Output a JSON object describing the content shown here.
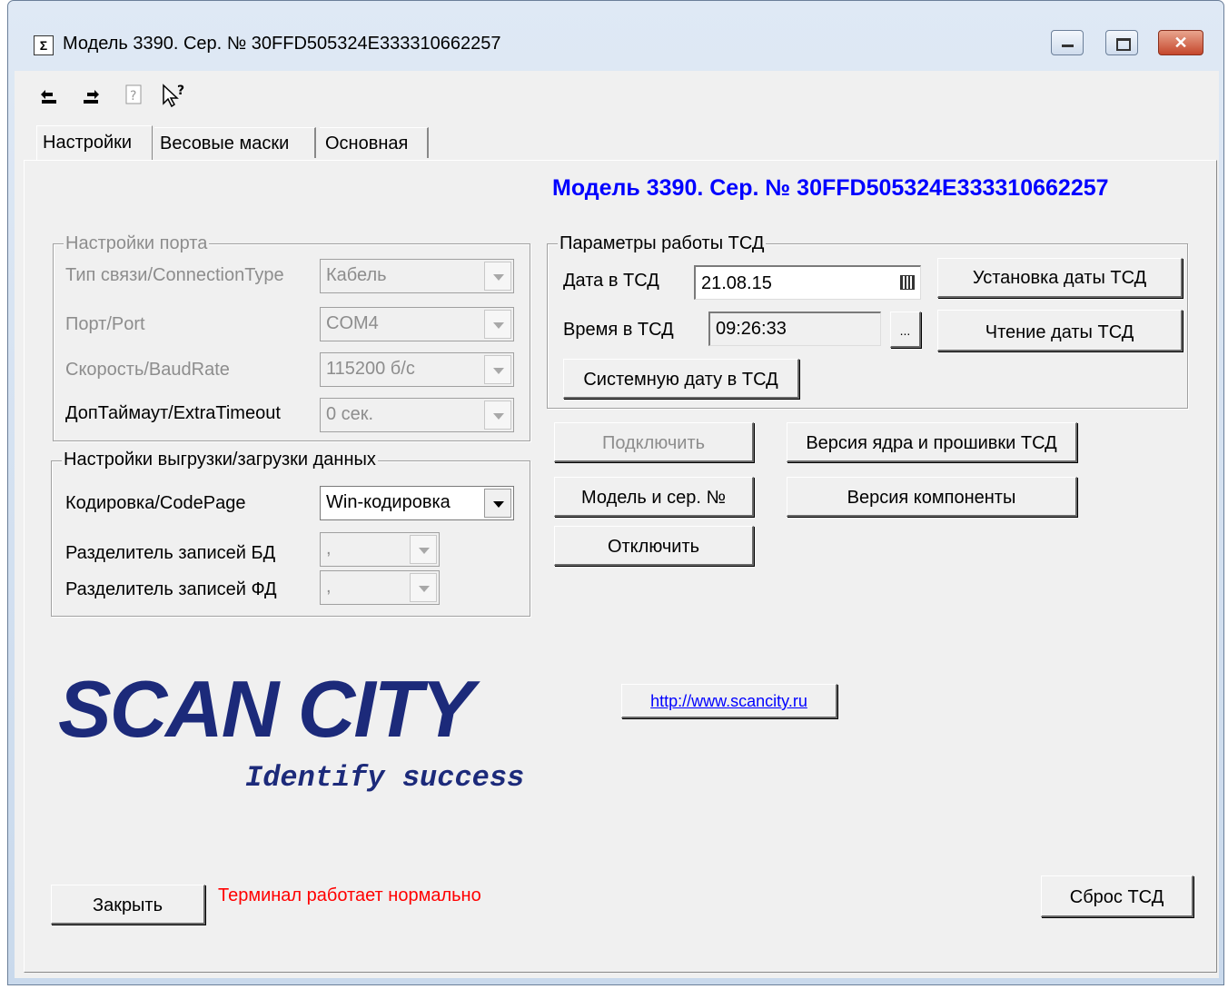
{
  "window": {
    "title": "Модель 3390. Сер. № 30FFD505324E333310662257",
    "icon": "sigma-app-icon"
  },
  "toolbar": {
    "icons": [
      "undo-icon",
      "redo-icon",
      "help-doc-icon",
      "context-help-icon"
    ]
  },
  "tabs": [
    {
      "label": "Настройки",
      "active": true
    },
    {
      "label": "Весовые маски",
      "active": false
    },
    {
      "label": "Основная",
      "active": false
    }
  ],
  "header_title": "Модель 3390. Сер. № 30FFD505324E333310662257",
  "port_group": {
    "title": "Настройки порта",
    "connection_label": "Тип связи/ConnectionType",
    "connection_value": "Кабель",
    "port_label": "Порт/Port",
    "port_value": "COM4",
    "baud_label": "Скорость/BaudRate",
    "baud_value": "115200 б/с",
    "timeout_label": "ДопТаймаут/ExtraTimeout",
    "timeout_value": "0 сек."
  },
  "data_group": {
    "title": "Настройки выгрузки/загрузки данных",
    "codepage_label": "Кодировка/CodePage",
    "codepage_value": "Win-кодировка",
    "db_sep_label": "Разделитель записей БД",
    "db_sep_value": ",",
    "fd_sep_label": "Разделитель записей ФД",
    "fd_sep_value": ","
  },
  "tsd_group": {
    "title": "Параметры работы ТСД",
    "date_label": "Дата в ТСД",
    "date_value": "21.08.15",
    "time_label": "Время в ТСД",
    "time_value": "09:26:33",
    "ellipsis": "...",
    "set_date_button": "Установка даты ТСД",
    "read_date_button": "Чтение даты ТСД",
    "system_date_button": "Системную дату в ТСД"
  },
  "actions": {
    "connect": "Подключить",
    "model_serial": "Модель и сер. №",
    "disconnect": "Отключить",
    "kernel_version": "Версия ядра и прошивки ТСД",
    "component_version": "Версия компоненты"
  },
  "branding": {
    "logo_text": "SCAN CITY",
    "slogan": "Identify success",
    "url": "http://www.scancity.ru"
  },
  "footer": {
    "close_button": "Закрыть",
    "status": "Терминал работает нормально",
    "reset_button": "Сброс ТСД"
  },
  "colors": {
    "header_title": "#0000ff",
    "status": "#ff0000",
    "logo": "#1c2a7a"
  }
}
